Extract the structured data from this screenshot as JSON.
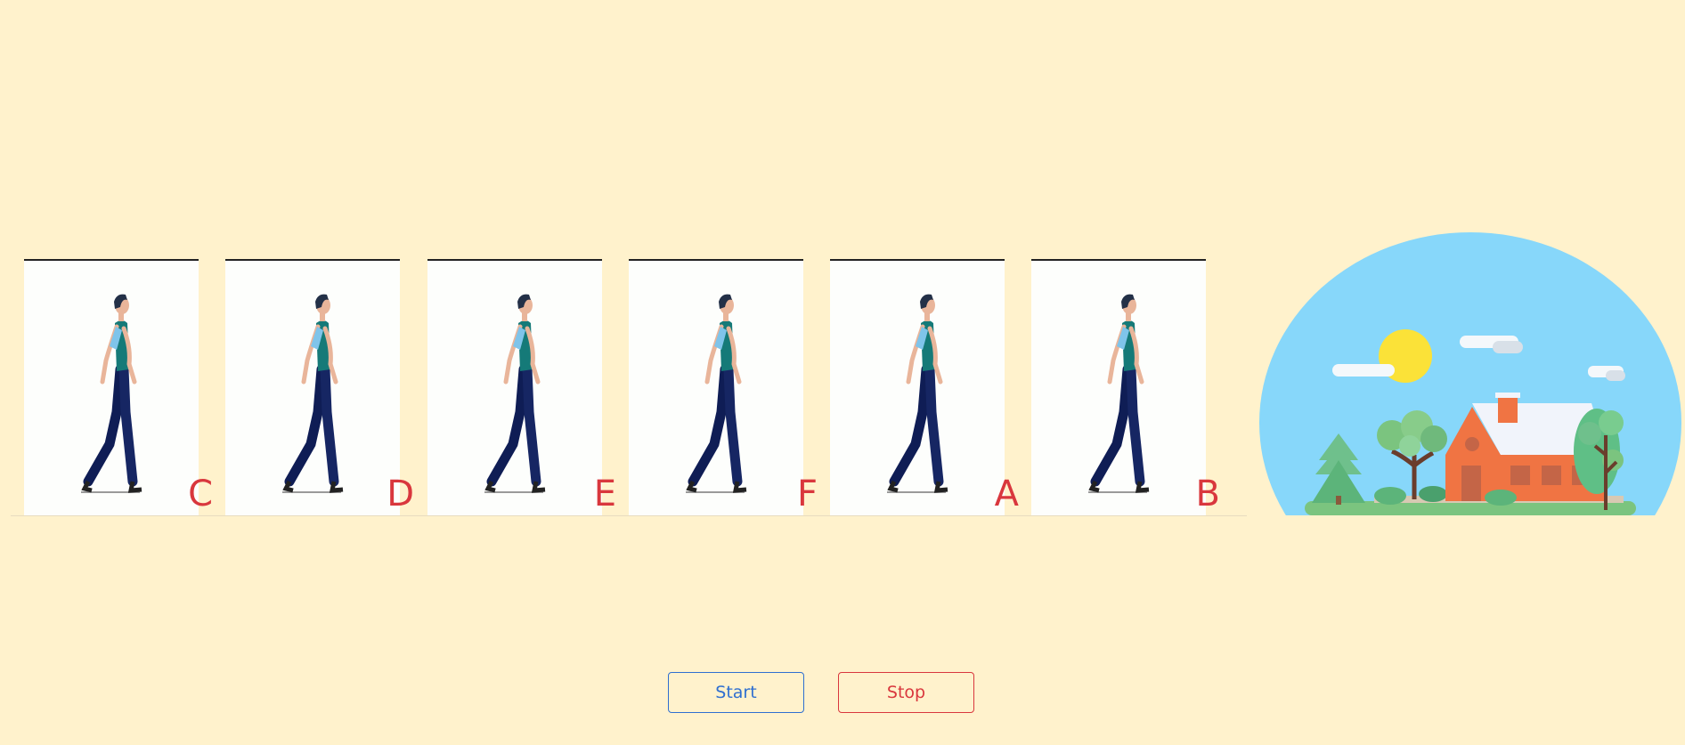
{
  "frames": [
    {
      "label": "C",
      "icon": "walking-man"
    },
    {
      "label": "D",
      "icon": "walking-man"
    },
    {
      "label": "E",
      "icon": "walking-man"
    },
    {
      "label": "F",
      "icon": "walking-man"
    },
    {
      "label": "A",
      "icon": "walking-man"
    },
    {
      "label": "B",
      "icon": "walking-man"
    }
  ],
  "scene": {
    "icon": "house-landscape"
  },
  "controls": {
    "start_label": "Start",
    "stop_label": "Stop"
  },
  "colors": {
    "background": "#fff2cc",
    "label": "#d9373d",
    "start": "#2f6fd0",
    "stop": "#d9373d",
    "sky": "#87d7fa",
    "sun": "#fbe238",
    "house": "#f07443",
    "grass": "#7bc47f"
  }
}
